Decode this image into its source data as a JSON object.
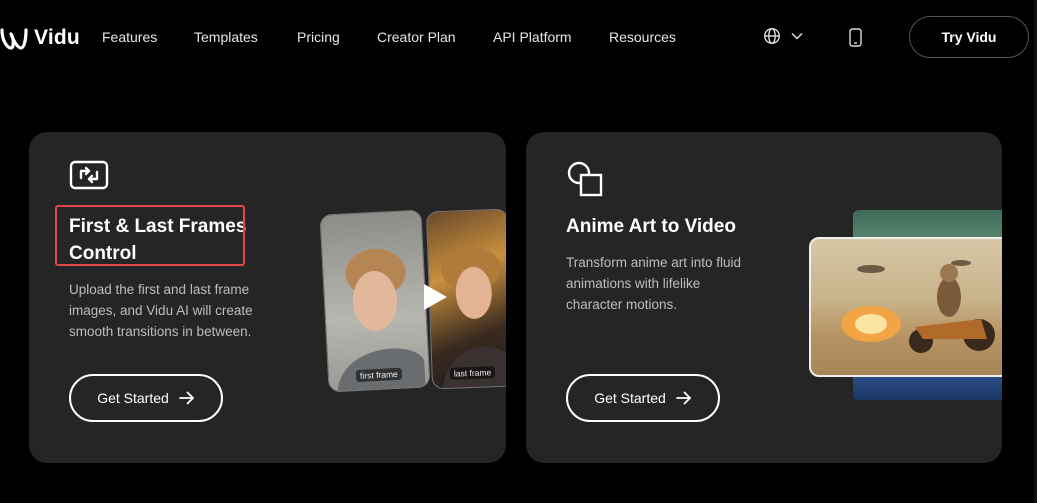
{
  "header": {
    "logo_text": "Vidu",
    "nav": [
      "Features",
      "Templates",
      "Pricing",
      "Creator Plan",
      "API Platform",
      "Resources"
    ],
    "cta": "Try Vidu"
  },
  "cards": [
    {
      "title_line1": "First & Last Frames",
      "title_line2": "Control",
      "desc_lines": [
        "Upload the first and last frame",
        "images, and Vidu AI will create",
        "smooth transitions in between."
      ],
      "button": "Get Started",
      "first_label": "first frame",
      "last_label": "last frame"
    },
    {
      "title": "Anime Art to Video",
      "desc_lines": [
        "Transform anime art into fluid",
        "animations with lifelike",
        "character motions."
      ],
      "button": "Get Started"
    }
  ],
  "colors": {
    "background": "#000000",
    "card": "#252525",
    "highlight": "#e34848"
  }
}
